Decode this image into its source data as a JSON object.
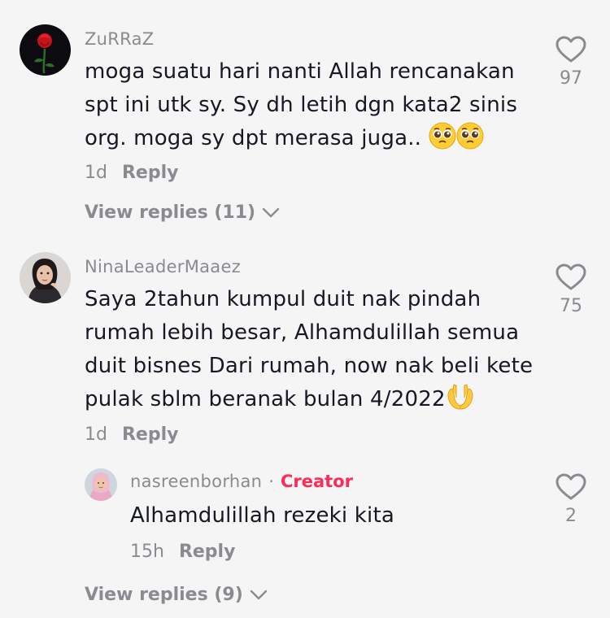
{
  "comments": [
    {
      "username": "ZuRRaZ",
      "text_lines": [
        "moga suatu hari nanti Allah rencanakan",
        "spt ini utk sy. Sy dh letih dgn kata2 sinis",
        "org. moga sy dpt merasa juga.."
      ],
      "emojis": [
        "🥺",
        "🥺"
      ],
      "time": "1d",
      "reply_label": "Reply",
      "likes": "97",
      "view_replies": "View replies (11)"
    },
    {
      "username": "NinaLeaderMaaez",
      "text_lines": [
        "Saya 2tahun kumpul duit nak pindah",
        "rumah lebih besar, Alhamdulillah semua",
        "duit bisnes Dari rumah, now nak beli kete",
        "pulak sblm beranak bulan 4/2022"
      ],
      "emojis": [
        "🤲"
      ],
      "time": "1d",
      "reply_label": "Reply",
      "likes": "75",
      "reply": {
        "username": "nasreenborhan",
        "separator": "·",
        "badge": "Creator",
        "text": "Alhamdulillah rezeki kita",
        "time": "15h",
        "reply_label": "Reply",
        "likes": "2"
      },
      "view_replies": "View replies (9)"
    }
  ],
  "colors": {
    "background": "#f5f5f6",
    "text": "#161823",
    "muted": "#8a8b91",
    "creator_badge": "#fe2c55"
  },
  "icons": {
    "like": "heart-outline-icon",
    "expand": "chevron-down-icon"
  }
}
